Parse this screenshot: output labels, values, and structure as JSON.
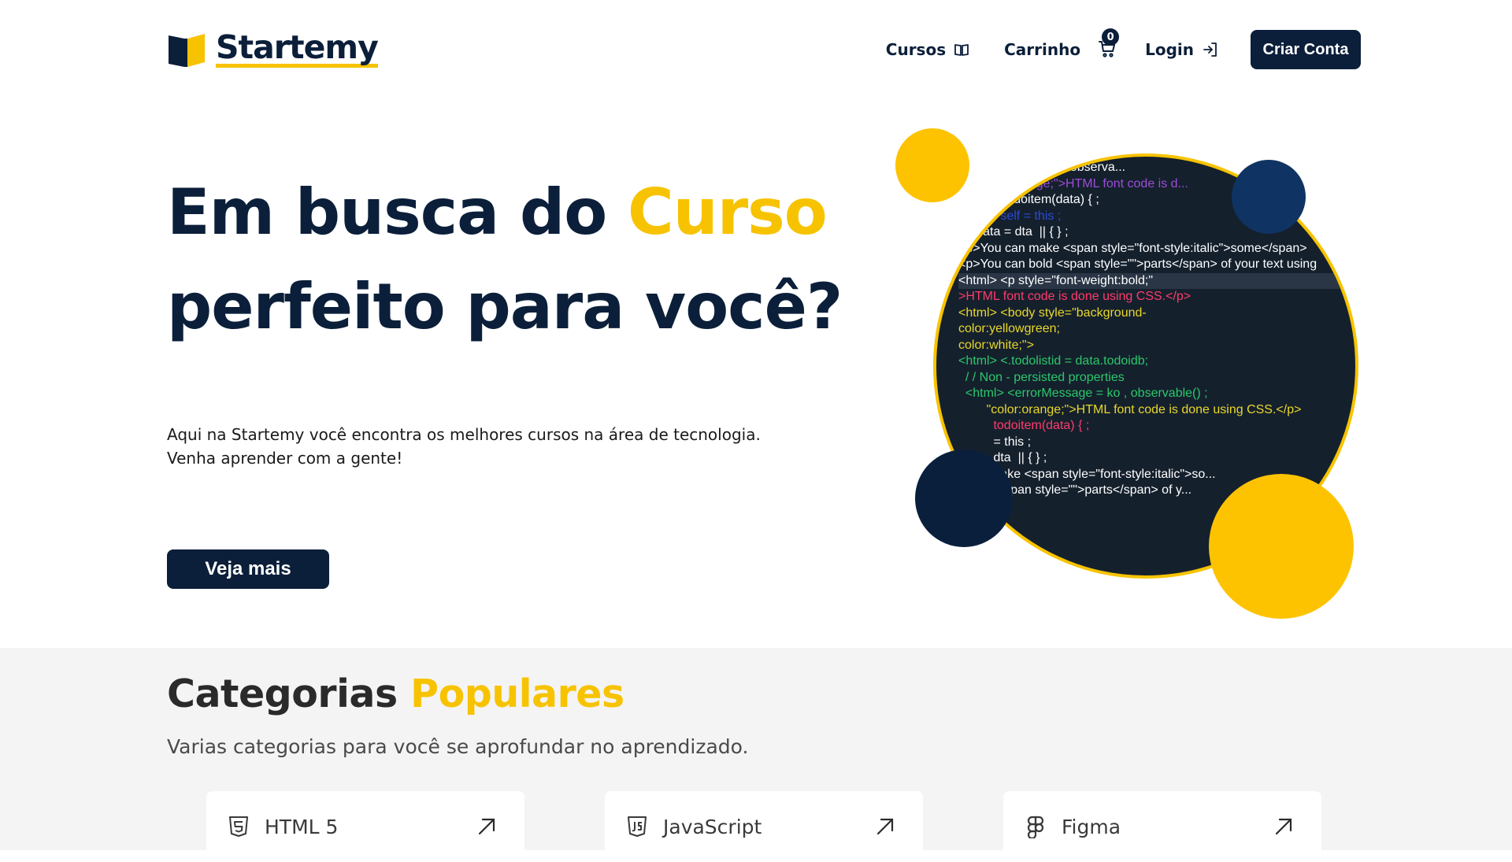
{
  "brand": {
    "name": "Startemy",
    "accent_color": "#f7c300",
    "primary_color": "#0b1f3a"
  },
  "nav": {
    "courses_label": "Cursos",
    "courses_icon": "book-open-icon",
    "cart_label": "Carrinho",
    "cart_icon": "cart-icon",
    "cart_count": "0",
    "login_label": "Login",
    "login_icon": "login-icon",
    "create_account_label": "Criar Conta"
  },
  "hero": {
    "title_part1": "Em busca do ",
    "title_accent": "Curso",
    "title_line2": "perfeito para você?",
    "subtitle_line1": "Aqui na Startemy você encontra os melhores cursos na área de tecnologia.",
    "subtitle_line2": "Venha aprender com a gente!",
    "cta_label": "Veja mais",
    "code_lines": [
      "            ...age = ko , observa...",
      "     ...olor:orange;\">HTML font code is d...",
      "   ...ion  todoitem(data) { ;",
      "     var  self = this ;",
      "     data = dta  || { } ;",
      "<p>You can make <span style=\"font-style:italic\">some</span>",
      "<p>You can bold <span style=\"\">parts</span> of your text using",
      "<html> <p style=\"font-weight:bold;\"",
      ">HTML font code is done using CSS.</p>",
      "<html> <body style=\"background-",
      "color:yellowgreen;",
      "color:white;\">",
      "<html> <.todolistid = data.todoidb;",
      "  / / Non - persisted properties",
      "  <html> <errorMessage = ko , observable() ;",
      "        \"color:orange;\">HTML font code is done using CSS.</p>",
      "          todoitem(data) { ;",
      "          = this ;",
      "          dta  || { } ;",
      "         make <span style=\"font-style:italic\">so...",
      "           <span style=\"\">parts</span> of y..."
    ]
  },
  "categories": {
    "title_part1": "Categorias ",
    "title_accent": "Populares",
    "subtitle": "Varias categorias para você se aprofundar no aprendizado.",
    "items": [
      {
        "label": "HTML 5",
        "icon": "html5-icon",
        "action_icon": "arrow-up-right-icon"
      },
      {
        "label": "JavaScript",
        "icon": "javascript-icon",
        "action_icon": "arrow-up-right-icon"
      },
      {
        "label": "Figma",
        "icon": "figma-icon",
        "action_icon": "arrow-up-right-icon"
      }
    ]
  }
}
